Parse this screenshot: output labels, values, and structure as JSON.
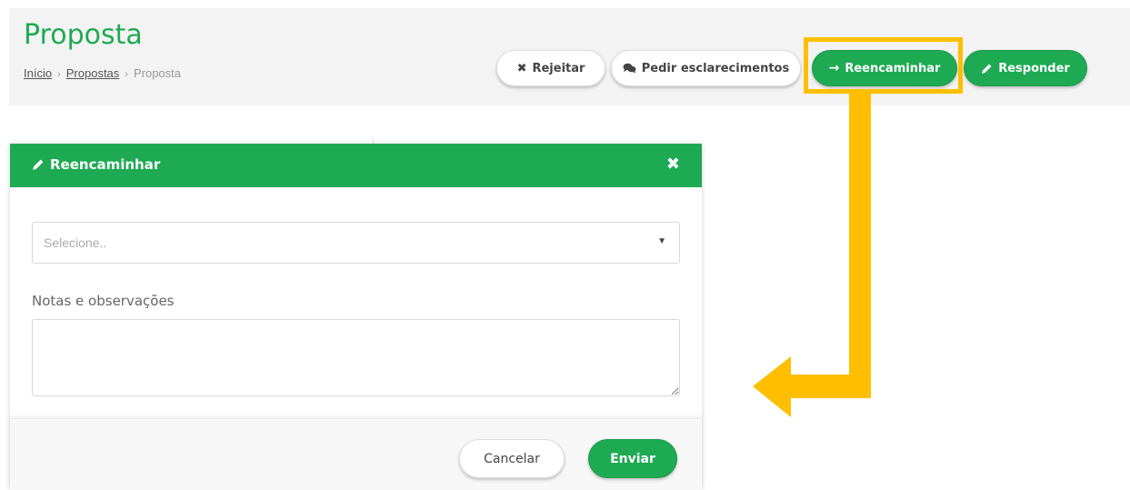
{
  "header": {
    "title": "Proposta",
    "breadcrumb": {
      "home": "Início",
      "separator": "›",
      "section": "Propostas",
      "current": "Proposta"
    }
  },
  "actions": {
    "reject": {
      "icon": "times-icon",
      "label": "Rejeitar"
    },
    "clarify": {
      "icon": "comments-icon",
      "label": "Pedir esclarecimentos"
    },
    "forward": {
      "icon": "arrow-right-icon",
      "label": "Reencaminhar"
    },
    "respond": {
      "icon": "pencil-icon",
      "label": "Responder"
    }
  },
  "modal": {
    "title": "Reencaminhar",
    "title_icon": "pencil-icon",
    "close_icon": "times-icon",
    "select": {
      "placeholder": "Selecione..",
      "caret_icon": "caret-down-icon"
    },
    "notes_label": "Notas e observações",
    "notes_value": "",
    "cancel_label": "Cancelar",
    "submit_label": "Enviar"
  },
  "colors": {
    "brand_green": "#1eaa53",
    "annotation_highlight": "#ffbf00",
    "header_background": "#f3f3f3"
  }
}
